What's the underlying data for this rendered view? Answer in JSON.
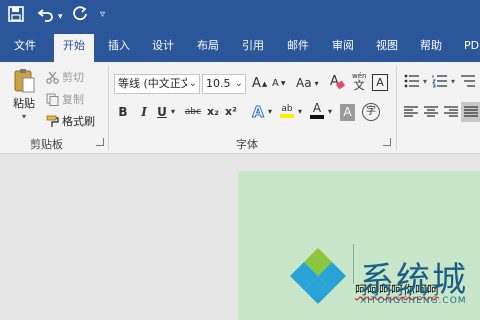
{
  "quick_access": {
    "save_icon": "save-icon",
    "undo_icon": "undo-icon",
    "redo_icon": "redo-icon",
    "customize_icon": "customize-icon"
  },
  "tabs": [
    {
      "label": "文件"
    },
    {
      "label": "开始",
      "active": true
    },
    {
      "label": "插入"
    },
    {
      "label": "设计"
    },
    {
      "label": "布局"
    },
    {
      "label": "引用"
    },
    {
      "label": "邮件"
    },
    {
      "label": "审阅"
    },
    {
      "label": "视图"
    },
    {
      "label": "帮助"
    },
    {
      "label": "PDI"
    }
  ],
  "clipboard": {
    "paste_label": "粘贴",
    "cut_label": "剪切",
    "copy_label": "复制",
    "format_painter_label": "格式刷",
    "group_label": "剪贴板"
  },
  "font": {
    "font_name": "等线 (中文正文",
    "font_size": "10.5",
    "group_label": "字体",
    "bold": "B",
    "italic": "I",
    "underline": "U",
    "strikethrough": "abc",
    "subscript": "x₂",
    "superscript": "x²",
    "text_effect": "A",
    "highlight": "ab",
    "font_color": "A",
    "char_shading": "A",
    "grow_font": "A",
    "shrink_font": "A",
    "change_case": "Aa",
    "clear_format": "A",
    "phonetic": "wén",
    "char_border": "A"
  },
  "document": {
    "text": "呵呵呵呵你呵呵"
  },
  "watermark": {
    "text": "系统城",
    "sub": "XITONGCHENG.COM"
  },
  "colors": {
    "ribbon_blue": "#2b579a",
    "page_green": "#c8e6c9"
  }
}
